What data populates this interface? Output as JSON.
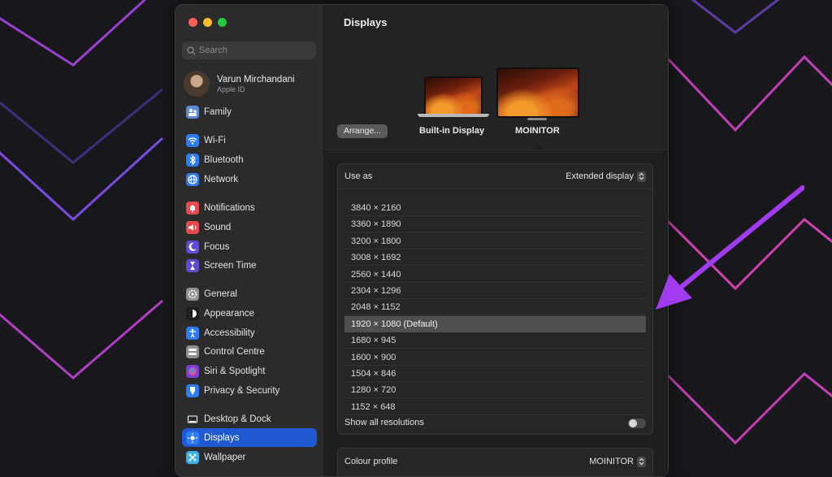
{
  "window": {
    "title": "Displays"
  },
  "sidebar": {
    "search_placeholder": "Search",
    "profile": {
      "name": "Varun Mirchandani",
      "subtitle": "Apple ID"
    },
    "items": [
      {
        "label": "Family",
        "icon": "family-icon",
        "color": "#5a8ad8"
      },
      {
        "label": "Wi-Fi",
        "icon": "wifi-icon",
        "color": "#2d7cf6"
      },
      {
        "label": "Bluetooth",
        "icon": "bluetooth-icon",
        "color": "#2d7cf6"
      },
      {
        "label": "Network",
        "icon": "network-icon",
        "color": "#2d7cf6"
      },
      {
        "label": "Notifications",
        "icon": "notifications-icon",
        "color": "#e8494f"
      },
      {
        "label": "Sound",
        "icon": "sound-icon",
        "color": "#e8494f"
      },
      {
        "label": "Focus",
        "icon": "focus-icon",
        "color": "#5d4bd3"
      },
      {
        "label": "Screen Time",
        "icon": "screen-time-icon",
        "color": "#5d4bd3"
      },
      {
        "label": "General",
        "icon": "general-icon",
        "color": "#8e8e93"
      },
      {
        "label": "Appearance",
        "icon": "appearance-icon",
        "color": "#1c1c1e"
      },
      {
        "label": "Accessibility",
        "icon": "accessibility-icon",
        "color": "#2d7cf6"
      },
      {
        "label": "Control Centre",
        "icon": "control-centre-icon",
        "color": "#8e8e93"
      },
      {
        "label": "Siri & Spotlight",
        "icon": "siri-icon",
        "color": "#7b3fd6"
      },
      {
        "label": "Privacy & Security",
        "icon": "privacy-icon",
        "color": "#2d7cf6"
      },
      {
        "label": "Desktop & Dock",
        "icon": "desktop-dock-icon",
        "color": "#2c2c2e"
      },
      {
        "label": "Displays",
        "icon": "displays-icon",
        "color": "#2d7cf6"
      },
      {
        "label": "Wallpaper",
        "icon": "wallpaper-icon",
        "color": "#3ab0e8"
      }
    ]
  },
  "main": {
    "arrange_label": "Arrange...",
    "displays": [
      {
        "label": "Built-in Display"
      },
      {
        "label": "MOINITOR"
      }
    ],
    "use_as": {
      "label": "Use as",
      "value": "Extended display"
    },
    "resolutions": [
      "3840 × 2160",
      "3360 × 1890",
      "3200 × 1800",
      "3008 × 1692",
      "2560 × 1440",
      "2304 × 1296",
      "2048 × 1152",
      "1920 × 1080 (Default)",
      "1680 × 945",
      "1600 × 900",
      "1504 × 846",
      "1280 × 720",
      "1152 × 648"
    ],
    "selected_resolution": "1920 × 1080 (Default)",
    "show_all_label": "Show all resolutions",
    "show_all_enabled": false,
    "colour_profile": {
      "label": "Colour profile",
      "value": "MOINITOR"
    }
  },
  "colors": {
    "accent": "#1f5ad1",
    "annotation_arrow": "#a23bf0"
  }
}
